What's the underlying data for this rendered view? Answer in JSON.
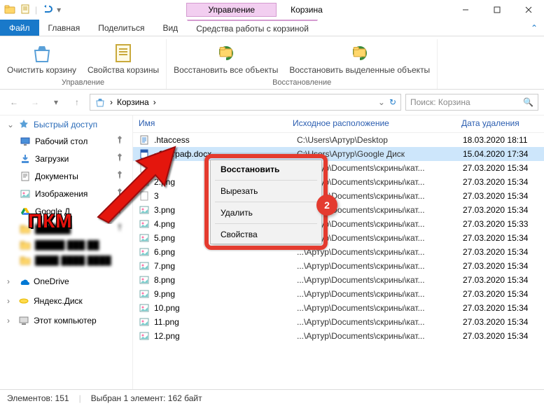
{
  "window": {
    "title": "Корзина",
    "context_tab_label": "Управление"
  },
  "tabs": {
    "file": "Файл",
    "home": "Главная",
    "share": "Поделиться",
    "view": "Вид",
    "context": "Средства работы с корзиной"
  },
  "ribbon": {
    "manage": {
      "empty": "Очистить корзину",
      "props": "Свойства корзины",
      "group_label": "Управление"
    },
    "restore": {
      "all": "Восстановить все объекты",
      "sel": "Восстановить выделенные объекты",
      "group_label": "Восстановление"
    }
  },
  "address": {
    "crumb": "Корзина",
    "sep": "›"
  },
  "search": {
    "placeholder": "Поиск: Корзина"
  },
  "sidebar": {
    "quick": "Быстрый доступ",
    "items": [
      {
        "label": "Рабочий стол",
        "pinned": true
      },
      {
        "label": "Загрузки",
        "pinned": true
      },
      {
        "label": "Документы",
        "pinned": true
      },
      {
        "label": "Изображения",
        "pinned": true
      },
      {
        "label": "Google Д",
        "pinned": true,
        "icon": "gdrive"
      },
      {
        "label": "██████",
        "pinned": true,
        "blur": true
      },
      {
        "label": "█████ ███ ██",
        "pinned": false,
        "blur": true
      },
      {
        "label": "████ ████ ████",
        "pinned": false,
        "blur": true
      }
    ],
    "onedrive": "OneDrive",
    "yadisk": "Яндекс.Диск",
    "thispc": "Этот компьютер"
  },
  "columns": {
    "name": "Имя",
    "location": "Исходное расположение",
    "date": "Дата удаления"
  },
  "rows": [
    {
      "name": ".htaccess",
      "loc": "C:\\Users\\Артур\\Desktop",
      "date": "18.03.2020 18:11",
      "icon": "txt"
    },
    {
      "name": "~$Штраф.docx",
      "loc": "C:\\Users\\Артур\\Google Диск",
      "date": "15.04.2020 17:34",
      "icon": "docx",
      "selected": true
    },
    {
      "name": "2",
      "loc": "...\\Артур\\Documents\\скрины\\кат...",
      "date": "27.03.2020 15:34",
      "icon": "file"
    },
    {
      "name": "2.png",
      "loc": "...\\Артур\\Documents\\скрины\\кат...",
      "date": "27.03.2020 15:34",
      "icon": "png"
    },
    {
      "name": "3",
      "loc": "...\\Артур\\Documents\\скрины\\кат...",
      "date": "27.03.2020 15:34",
      "icon": "file"
    },
    {
      "name": "3.png",
      "loc": "...\\Артур\\Documents\\скрины\\кат...",
      "date": "27.03.2020 15:34",
      "icon": "png"
    },
    {
      "name": "4.png",
      "loc": "...\\Артур\\Documents\\скрины\\кат...",
      "date": "27.03.2020 15:33",
      "icon": "png"
    },
    {
      "name": "5.png",
      "loc": "...\\Артур\\Documents\\скрины\\кат...",
      "date": "27.03.2020 15:34",
      "icon": "png"
    },
    {
      "name": "6.png",
      "loc": "...\\Артур\\Documents\\скрины\\кат...",
      "date": "27.03.2020 15:34",
      "icon": "png"
    },
    {
      "name": "7.png",
      "loc": "...\\Артур\\Documents\\скрины\\кат...",
      "date": "27.03.2020 15:34",
      "icon": "png"
    },
    {
      "name": "8.png",
      "loc": "...\\Артур\\Documents\\скрины\\кат...",
      "date": "27.03.2020 15:34",
      "icon": "png"
    },
    {
      "name": "9.png",
      "loc": "...\\Артур\\Documents\\скрины\\кат...",
      "date": "27.03.2020 15:34",
      "icon": "png"
    },
    {
      "name": "10.png",
      "loc": "...\\Артур\\Documents\\скрины\\кат...",
      "date": "27.03.2020 15:34",
      "icon": "png"
    },
    {
      "name": "11.png",
      "loc": "...\\Артур\\Documents\\скрины\\кат...",
      "date": "27.03.2020 15:34",
      "icon": "png"
    },
    {
      "name": "12.png",
      "loc": "...\\Артур\\Documents\\скрины\\кат...",
      "date": "27.03.2020 15:34",
      "icon": "png"
    }
  ],
  "context_menu": {
    "restore": "Восстановить",
    "cut": "Вырезать",
    "delete": "Удалить",
    "props": "Свойства",
    "badge": "2"
  },
  "annotation": {
    "pkm": "ПКМ"
  },
  "status": {
    "count_label": "Элементов:",
    "count": "151",
    "sel_label": "Выбран 1 элемент:",
    "sel_size": "162 байт"
  }
}
